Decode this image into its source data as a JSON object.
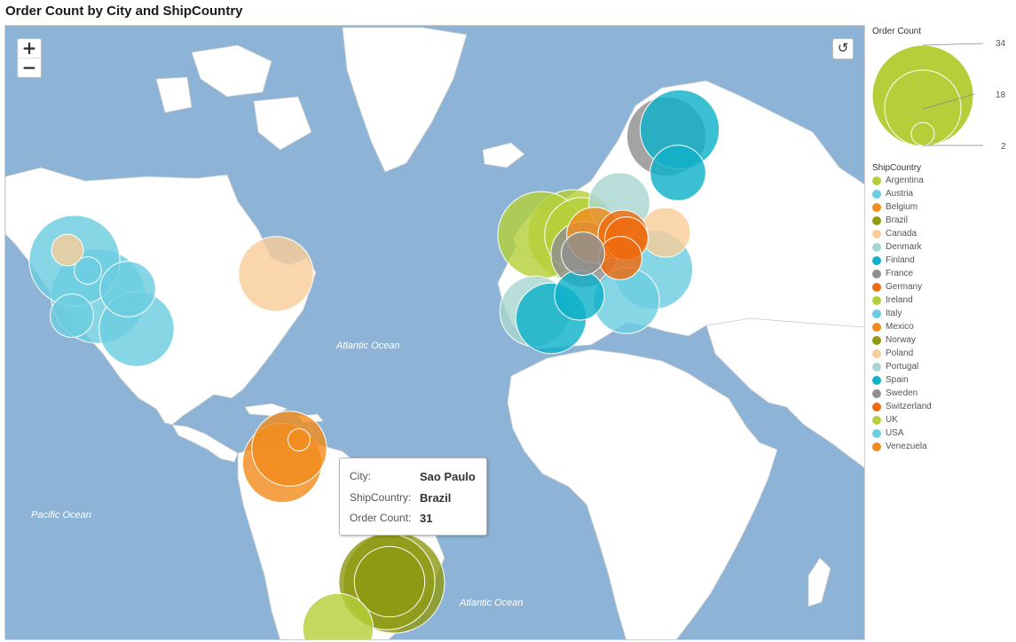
{
  "title": "Order Count by City and ShipCountry",
  "controls": {
    "zoom_in": "+",
    "zoom_out": "−",
    "reset_glyph": "↺"
  },
  "ocean_labels": [
    "Atlantic Ocean",
    "Pacific Ocean",
    "Atlantic Ocean"
  ],
  "tooltip": {
    "city_label": "City:",
    "city": "Sao Paulo",
    "country_label": "ShipCountry:",
    "country": "Brazil",
    "count_label": "Order Count:",
    "count": "31"
  },
  "legend": {
    "size_title": "Order Count",
    "size_ticks": [
      "34",
      "18",
      "2"
    ],
    "color_title": "ShipCountry",
    "items": [
      {
        "name": "Argentina",
        "color": "#b5cf3a"
      },
      {
        "name": "Austria",
        "color": "#6dcde0"
      },
      {
        "name": "Belgium",
        "color": "#f28c1e"
      },
      {
        "name": "Brazil",
        "color": "#8f9a14"
      },
      {
        "name": "Canada",
        "color": "#f8cd98"
      },
      {
        "name": "Denmark",
        "color": "#a9d6d0"
      },
      {
        "name": "Finland",
        "color": "#0fb1c9"
      },
      {
        "name": "France",
        "color": "#8f8f8f"
      },
      {
        "name": "Germany",
        "color": "#ee6b0f"
      },
      {
        "name": "Ireland",
        "color": "#b5cf3a"
      },
      {
        "name": "Italy",
        "color": "#6dcde0"
      },
      {
        "name": "Mexico",
        "color": "#f28c1e"
      },
      {
        "name": "Norway",
        "color": "#8f9a14"
      },
      {
        "name": "Poland",
        "color": "#f8cd98"
      },
      {
        "name": "Portugal",
        "color": "#a9d6d0"
      },
      {
        "name": "Spain",
        "color": "#0fb1c9"
      },
      {
        "name": "Sweden",
        "color": "#8f8f8f"
      },
      {
        "name": "Switzerland",
        "color": "#ee6b0f"
      },
      {
        "name": "UK",
        "color": "#b5cf3a"
      },
      {
        "name": "USA",
        "color": "#6dcde0"
      },
      {
        "name": "Venezuela",
        "color": "#f28c1e"
      }
    ]
  },
  "colors": {
    "ocean": "#8db4d6",
    "land": "#ffffff"
  },
  "chart_data": {
    "type": "bubble-map",
    "value_range": [
      2,
      34
    ],
    "points": [
      {
        "country": "USA",
        "count": 30
      },
      {
        "country": "USA",
        "count": 20
      },
      {
        "country": "USA",
        "count": 12
      },
      {
        "country": "USA",
        "count": 8
      },
      {
        "country": "USA",
        "count": 4
      },
      {
        "country": "USA",
        "count": 28
      },
      {
        "country": "Canada",
        "count": 5
      },
      {
        "country": "Canada",
        "count": 20
      },
      {
        "country": "Mexico",
        "count": 22
      },
      {
        "country": "Venezuela",
        "count": 20
      },
      {
        "country": "Venezuela",
        "count": 3
      },
      {
        "country": "Brazil",
        "count": 34
      },
      {
        "country": "Brazil",
        "count": 31
      },
      {
        "country": "Brazil",
        "count": 18
      },
      {
        "country": "Argentina",
        "count": 18
      },
      {
        "country": "Sweden",
        "count": 22
      },
      {
        "country": "Finland",
        "count": 22
      },
      {
        "country": "Finland",
        "count": 12
      },
      {
        "country": "Denmark",
        "count": 14
      },
      {
        "country": "Ireland",
        "count": 26
      },
      {
        "country": "UK",
        "count": 28
      },
      {
        "country": "UK",
        "count": 20
      },
      {
        "country": "Austria",
        "count": 22
      },
      {
        "country": "Poland",
        "count": 10
      },
      {
        "country": "Belgium",
        "count": 12
      },
      {
        "country": "Germany",
        "count": 10
      },
      {
        "country": "Germany",
        "count": 8
      },
      {
        "country": "Switzerland",
        "count": 8
      },
      {
        "country": "France",
        "count": 16
      },
      {
        "country": "France",
        "count": 8
      },
      {
        "country": "Portugal",
        "count": 18
      },
      {
        "country": "Spain",
        "count": 18
      },
      {
        "country": "Spain",
        "count": 10
      },
      {
        "country": "Italy",
        "count": 16
      }
    ]
  }
}
